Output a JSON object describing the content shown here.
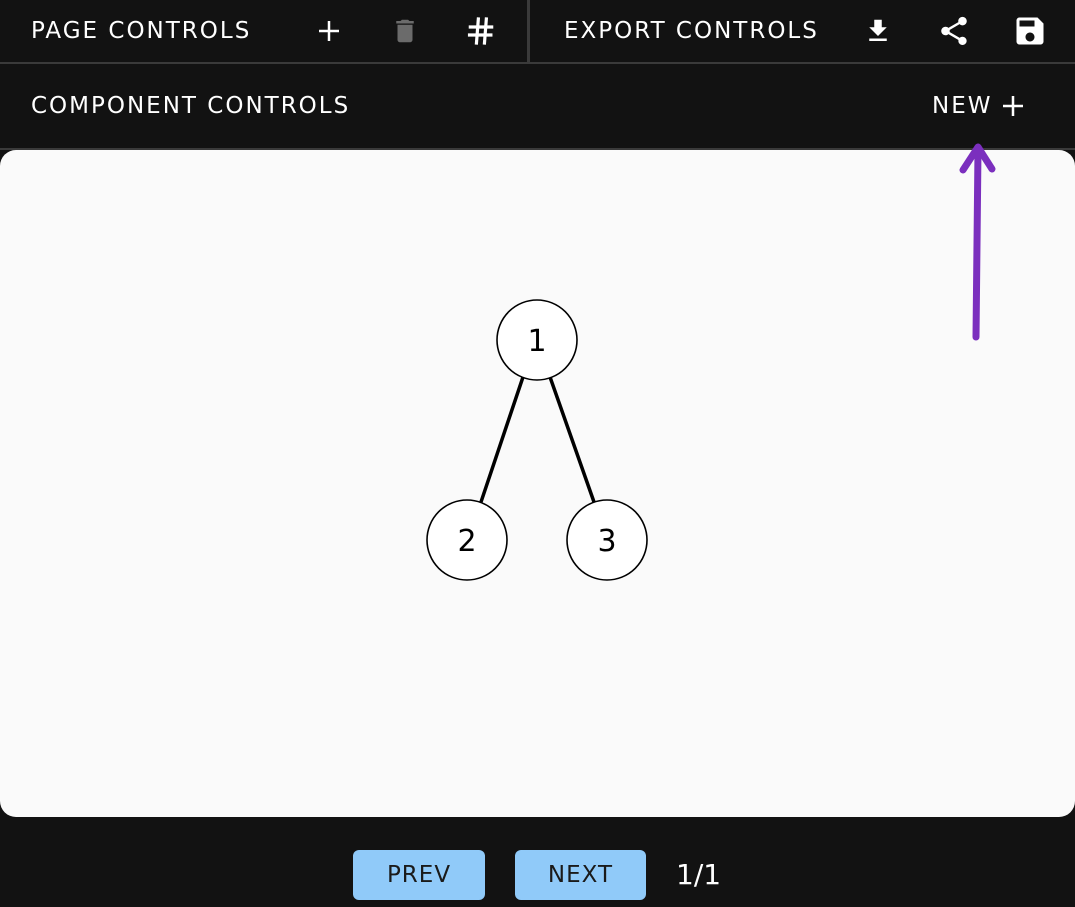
{
  "top_bar": {
    "page_controls_label": "PAGE CONTROLS",
    "export_controls_label": "EXPORT CONTROLS",
    "page_icons": [
      "add-icon",
      "trash-icon",
      "hash-icon"
    ],
    "export_icons": [
      "download-icon",
      "share-icon",
      "save-icon"
    ]
  },
  "component_bar": {
    "label": "COMPONENT CONTROLS",
    "new_label": "NEW",
    "new_icon": "add-icon"
  },
  "canvas": {
    "nodes": [
      {
        "label": "1"
      },
      {
        "label": "2"
      },
      {
        "label": "3"
      }
    ],
    "edges": [
      {
        "from": "1",
        "to": "2"
      },
      {
        "from": "1",
        "to": "3"
      }
    ],
    "annotation": {
      "type": "arrow",
      "points_to": "new-button",
      "color": "#7b2fbe"
    }
  },
  "pager": {
    "prev_label": "PREV",
    "next_label": "NEXT",
    "page_indicator": "1/1"
  },
  "colors": {
    "background": "#121212",
    "canvas": "#fafafa",
    "button": "#90caf9",
    "disabled_icon": "#6b6b6b",
    "divider": "#3a3a3a",
    "annotation": "#7b2fbe"
  }
}
